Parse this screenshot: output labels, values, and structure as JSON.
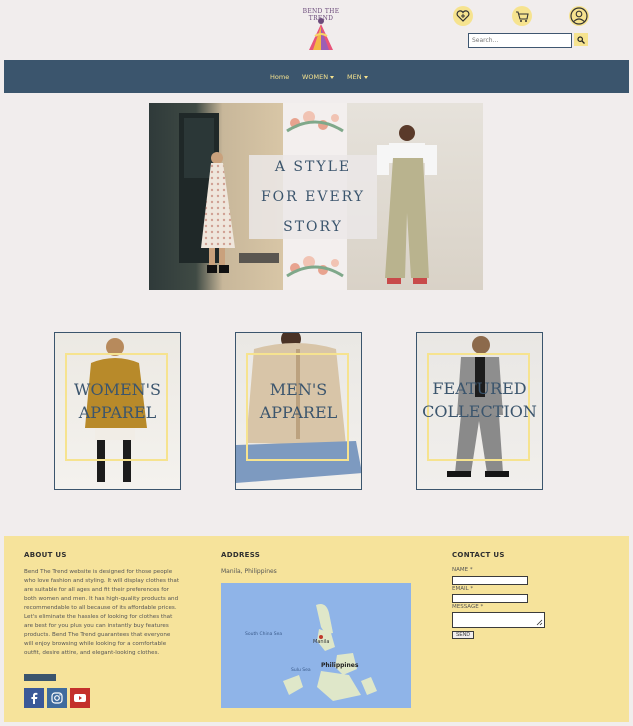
{
  "brand": {
    "logo_text": "BEND THE TREND"
  },
  "header": {
    "icons": [
      "wishlist-heart-icon",
      "cart-icon",
      "user-icon"
    ],
    "search_placeholder": "Search..."
  },
  "nav": {
    "items": [
      {
        "label": "Home",
        "dropdown": false
      },
      {
        "label": "WOMEN",
        "dropdown": true
      },
      {
        "label": "MEN",
        "dropdown": true
      }
    ]
  },
  "hero": {
    "line1": "A STYLE FOR EVERY",
    "line2": "STORY"
  },
  "categories": [
    {
      "line1": "WOMEN'S",
      "line2": "APPAREL"
    },
    {
      "line1": "MEN'S",
      "line2": "APPAREL"
    },
    {
      "line1": "FEATURED",
      "line2": "COLLECTION"
    }
  ],
  "footer": {
    "about_title": "ABOUT US",
    "about_text": "Bend The Trend website is designed for those people who love fashion and styling. It will display clothes that are suitable for all ages and fit their preferences for both women and men. It has high-quality products and recommendable to all because of its affordable prices. Let's eliminate the hassles of looking for clothes that are best for you plus you can instantly buy features products. Bend The Trend guarantees that everyone will enjoy browsing while looking for a comfortable outfit, desire attire, and elegant-looking clothes.",
    "address_title": "ADDRESS",
    "address_text": "Manila, Philippines",
    "map_labels": {
      "country": "Philippines",
      "city": "Manila",
      "sea1": "South China Sea",
      "sea2": "Sulu Sea"
    },
    "contact_title": "CONTACT US",
    "name_label": "NAME *",
    "email_label": "EMAIL *",
    "message_label": "MESSAGE *",
    "send_label": "SEND",
    "social": [
      "facebook-icon",
      "instagram-icon",
      "youtube-icon"
    ]
  },
  "colors": {
    "navy": "#3b556d",
    "yellow": "#f6e38f",
    "bg": "#f1eded",
    "footer": "#f6e39b"
  }
}
